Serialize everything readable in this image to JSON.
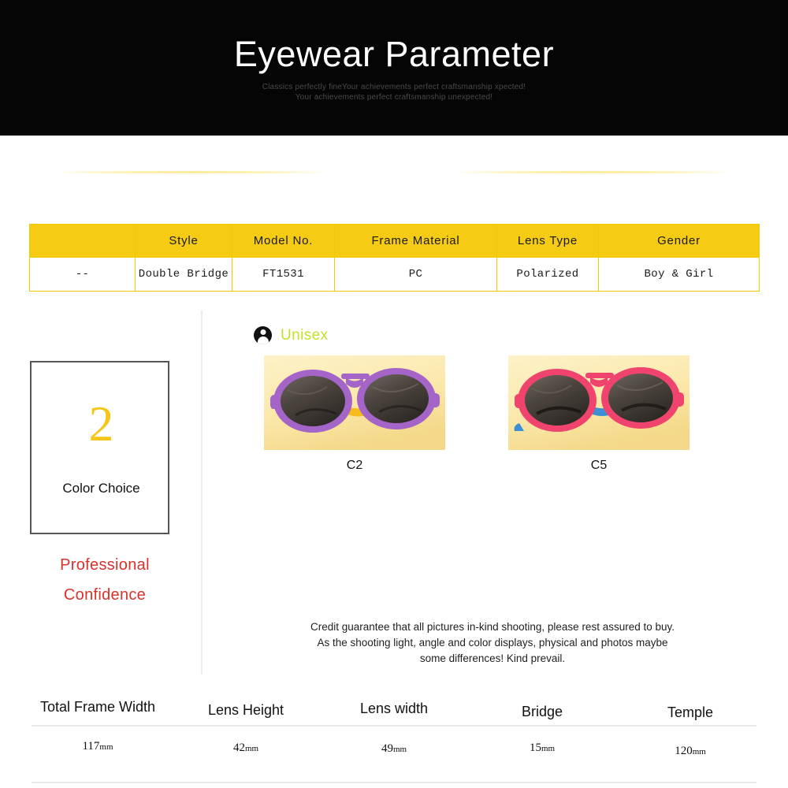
{
  "hero": {
    "title": "Eyewear Parameter",
    "subtitle_line1": "Classics perfectly fineYour  achievements perfect craftsmanship xpected!",
    "subtitle_line2": "Your achievements perfect craftsmanship unexpected!",
    "background_color": "#050505",
    "title_color": "#ffffff",
    "subtitle_color": "#4a4a4a"
  },
  "spec_table": {
    "header_bg": "#f5cb13",
    "border_color": "#f3c800",
    "headers": [
      "",
      "Style",
      "Model No.",
      "Frame Material",
      "Lens Type",
      "Gender"
    ],
    "row": [
      "--",
      "Double Bridge",
      "FT1531",
      "PC",
      "Polarized",
      "Boy & Girl"
    ]
  },
  "left_panel": {
    "number": "2",
    "number_color": "#f5c518",
    "label": "Color Choice",
    "tagline_line1": "Professional",
    "tagline_line2": "Confidence",
    "tagline_color": "#d9312c"
  },
  "gender_section": {
    "icon": "person-circle-icon",
    "label": "Unisex",
    "label_color": "#c5e02a"
  },
  "colors": [
    {
      "caption": "C2",
      "frame_color": "#a564c8",
      "lens_color": "#4a443f",
      "temple_color": "#f6c21c",
      "background": "#fbe9ad"
    },
    {
      "caption": "C5",
      "frame_color": "#f0446e",
      "lens_color": "#4a443f",
      "temple_color": "#3b8fd4",
      "background": "#fbe9ad"
    }
  ],
  "disclaimer": {
    "line1": "Credit guarantee that all pictures in-kind shooting, please rest assured to buy.",
    "line2": "As the shooting light, angle and color displays, physical and photos maybe",
    "line3": "some differences! Kind prevail."
  },
  "measurements": {
    "labels": [
      "Total Frame Width",
      "Lens Height",
      "Lens width",
      "Bridge",
      "Temple"
    ],
    "values": [
      "117",
      "42",
      "49",
      "15",
      "120"
    ],
    "unit": "mm"
  }
}
